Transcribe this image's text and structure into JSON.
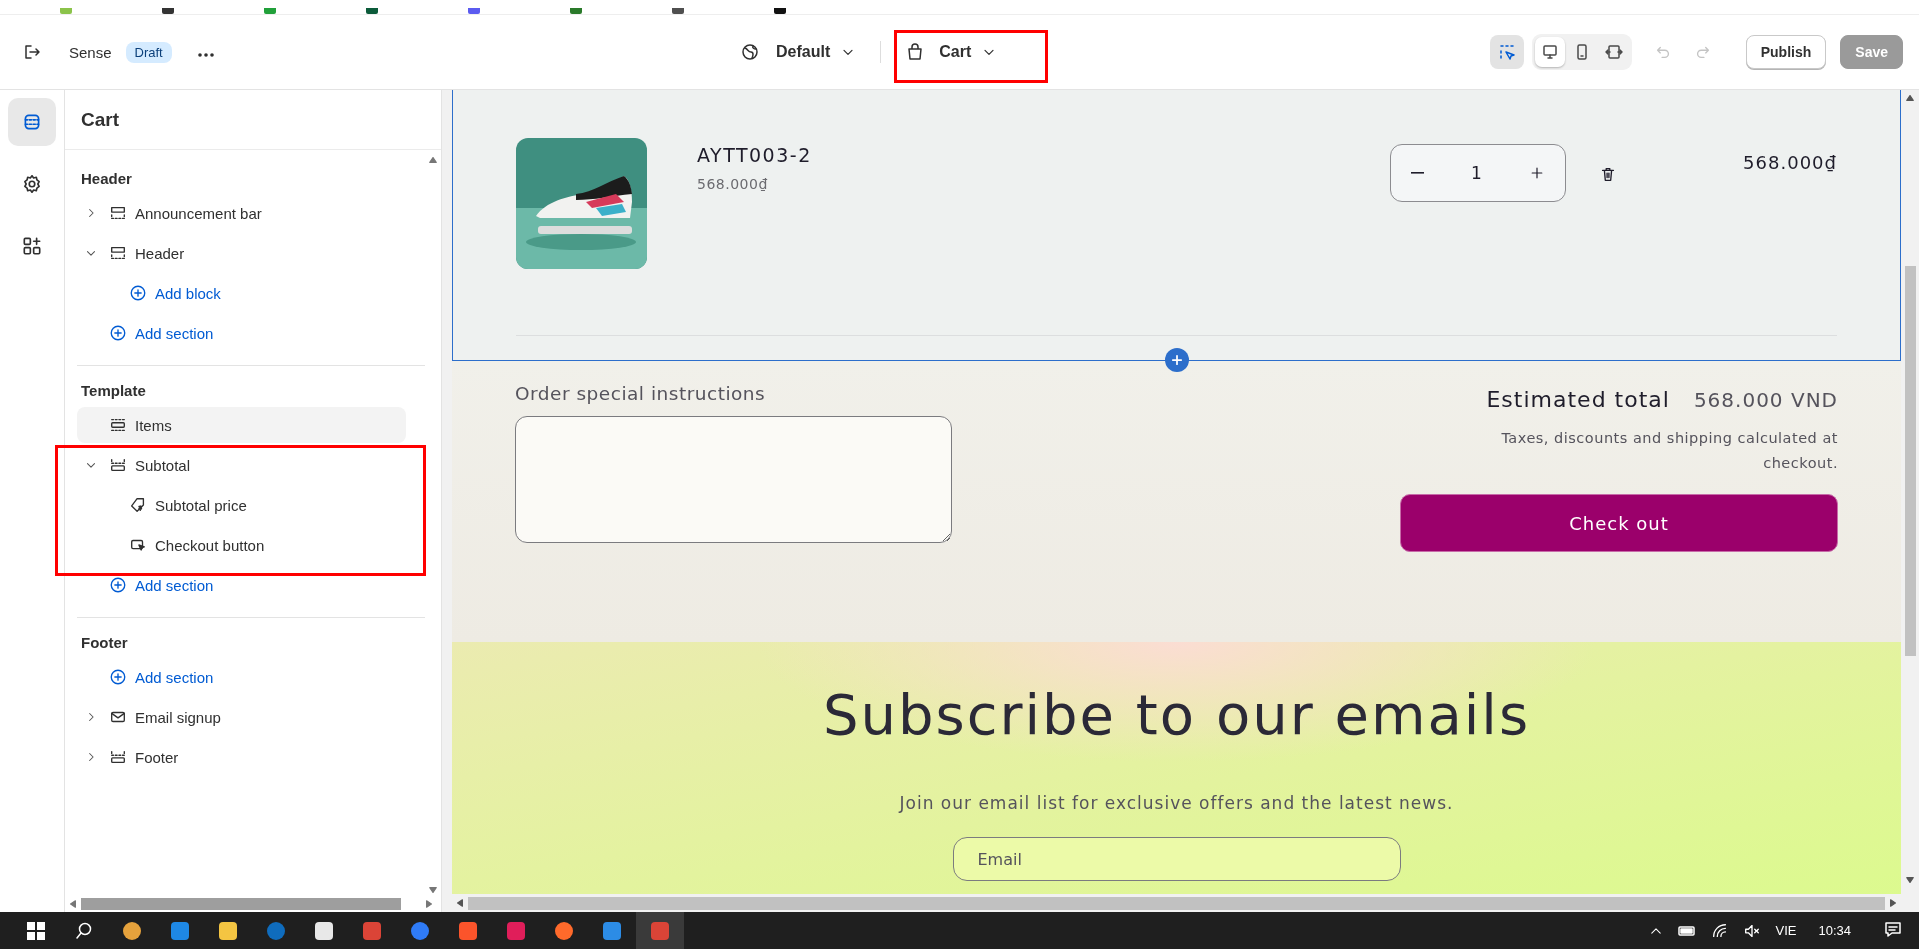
{
  "editor": {
    "theme_name": "Sense",
    "theme_status": "Draft",
    "view": "Default",
    "template": "Cart",
    "devices": [
      {
        "kind": "desktop",
        "selected": true
      },
      {
        "kind": "mobile",
        "selected": false
      },
      {
        "kind": "fullwidth",
        "selected": false
      }
    ],
    "inspector": {
      "on": true
    },
    "buttons": [
      {
        "label": "Publish",
        "disabled": false
      },
      {
        "label": "Save",
        "disabled": true
      }
    ]
  },
  "rail": [
    {
      "kind": "sections",
      "selected": true
    },
    {
      "kind": "settings",
      "selected": false
    },
    {
      "kind": "apps",
      "selected": false
    }
  ],
  "sidebar": {
    "title": "Cart",
    "groups": [
      {
        "title": "Header",
        "items": [
          {
            "kind": "header",
            "label": "Announcement bar",
            "expanded": false,
            "selected": false
          },
          {
            "kind": "header",
            "label": "Header",
            "expanded": true,
            "selected": false,
            "children": [
              {
                "kind": "add",
                "label": "Add block",
                "selected": false
              }
            ]
          },
          {
            "kind": "add",
            "label": "Add section",
            "selected": false
          }
        ]
      },
      {
        "title": "Template",
        "items": [
          {
            "kind": "items",
            "label": "Items",
            "selected": true
          },
          {
            "kind": "footer",
            "label": "Subtotal",
            "expanded": true,
            "selected": false,
            "children": [
              {
                "kind": "price",
                "label": "Subtotal price",
                "selected": false
              },
              {
                "kind": "checkout",
                "label": "Checkout button",
                "selected": false
              }
            ]
          },
          {
            "kind": "add",
            "label": "Add section",
            "selected": false
          }
        ]
      },
      {
        "title": "Footer",
        "items": [
          {
            "kind": "add",
            "label": "Add section",
            "selected": false
          },
          {
            "kind": "email",
            "label": "Email signup",
            "expanded": false,
            "selected": false
          },
          {
            "kind": "footer",
            "label": "Footer",
            "expanded": false,
            "selected": false
          }
        ]
      }
    ]
  },
  "cart": {
    "items": [
      {
        "title": "AYTT003-2",
        "price": "568.000₫",
        "quantity": "1",
        "line_total": "568.000₫"
      }
    ],
    "note_label": "Order special instructions",
    "total_label": "Estimated total",
    "total": "568.000 VND",
    "tax_note": "Taxes, discounts and shipping calculated at checkout.",
    "checkout": "Check out"
  },
  "newsletter": {
    "heading": "Subscribe to our emails",
    "text": "Join our email list for exclusive offers and the latest news.",
    "placeholder": "Email"
  },
  "taskbar": {
    "language": "VIE",
    "time": "10:34"
  }
}
